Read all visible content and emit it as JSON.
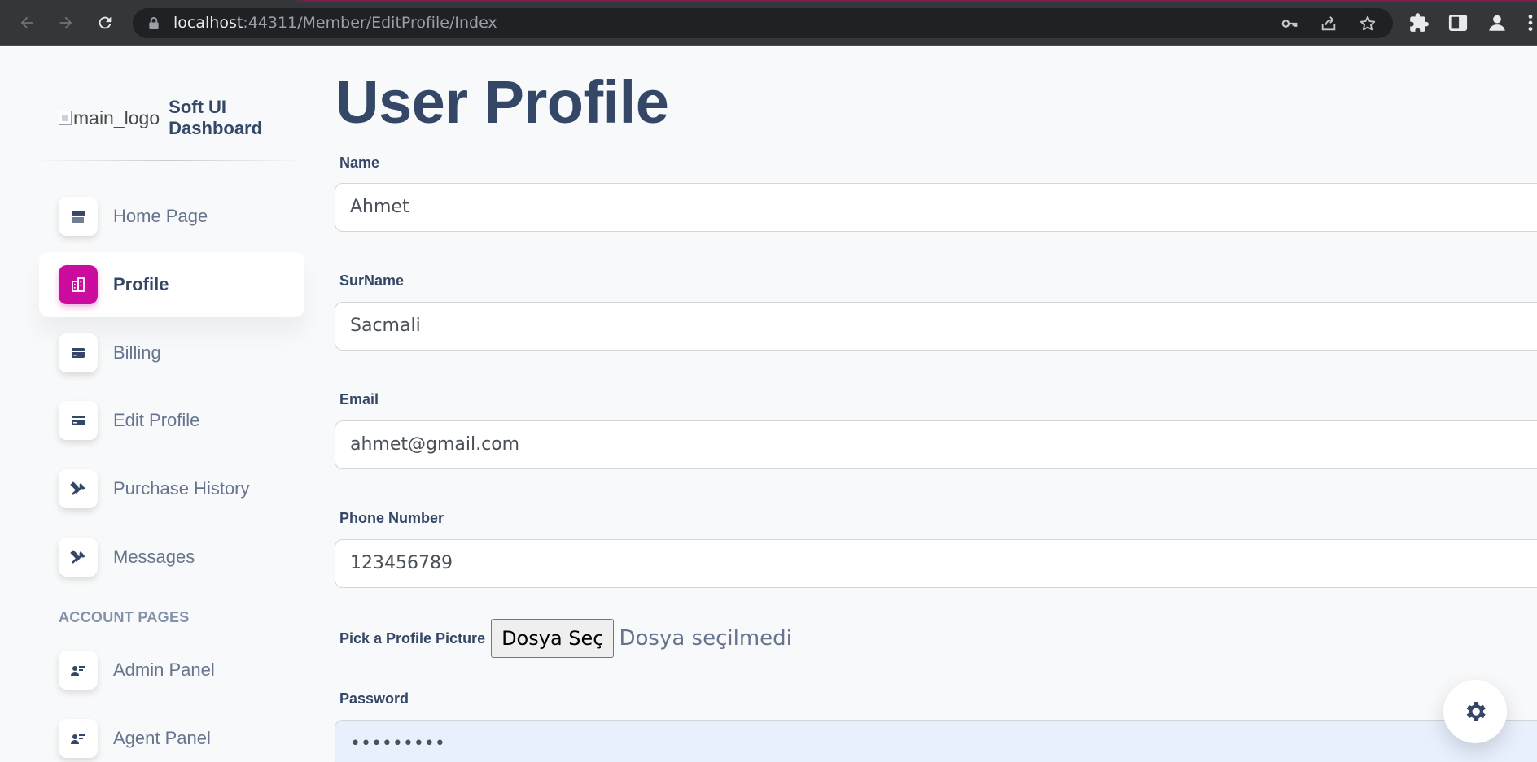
{
  "browser": {
    "url_host": "localhost",
    "url_rest": ":44311/Member/EditProfile/Index"
  },
  "sidebar": {
    "logo_alt": "main_logo",
    "brand": "Soft UI Dashboard",
    "items": [
      {
        "label": "Home Page",
        "icon": "shop-icon"
      },
      {
        "label": "Profile",
        "icon": "office-icon"
      },
      {
        "label": "Billing",
        "icon": "credit-card-icon"
      },
      {
        "label": "Edit Profile",
        "icon": "credit-card-icon"
      },
      {
        "label": "Purchase History",
        "icon": "tools-icon"
      },
      {
        "label": "Messages",
        "icon": "tools-icon"
      },
      {
        "label": "Admin Panel",
        "icon": "user-card-icon"
      },
      {
        "label": "Agent Panel",
        "icon": "user-card-icon"
      }
    ],
    "section_title": "ACCOUNT PAGES"
  },
  "main": {
    "title": "User Profile",
    "fields": {
      "name": {
        "label": "Name",
        "value": "Ahmet"
      },
      "surname": {
        "label": "SurName",
        "value": "Sacmali"
      },
      "email": {
        "label": "Email",
        "value": "ahmet@gmail.com"
      },
      "phone": {
        "label": "Phone Number",
        "value": "123456789"
      },
      "password": {
        "label": "Password",
        "value": "•••••••••"
      }
    },
    "file_picker": {
      "label": "Pick a Profile Picture",
      "button": "Dosya Seç",
      "status": "Dosya seçilmedi"
    }
  },
  "colors": {
    "primary_text": "#344767",
    "secondary_text": "#67748e",
    "active_icon_bg": "#cb0c9f",
    "page_bg": "#f8f9fa"
  }
}
